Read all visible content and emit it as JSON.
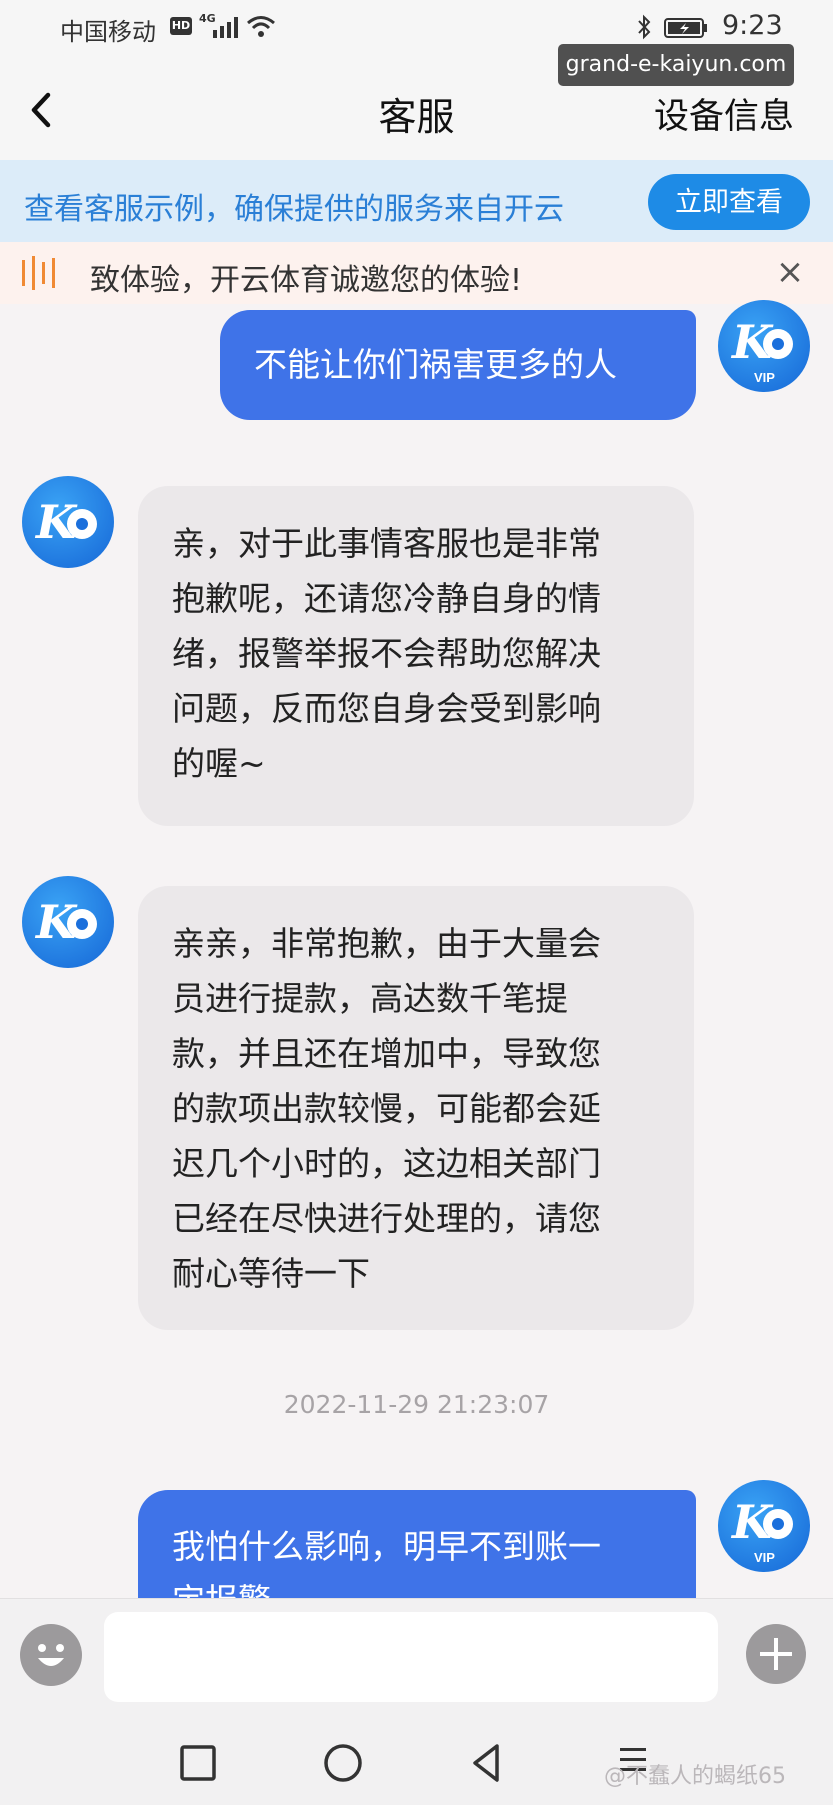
{
  "status_bar": {
    "carrier": "中国移动",
    "hd": "HD",
    "network": "4G",
    "time": "9:23"
  },
  "watermark": {
    "url": "grand-e-kaiyun.com",
    "author": "@不蠢人的蝎纸65"
  },
  "header": {
    "title": "客服",
    "right_action": "设备信息"
  },
  "tip_banner": {
    "text": "查看客服示例，确保提供的服务来自开云",
    "button": "立即查看"
  },
  "notice": {
    "text": "致体验，开云体育诚邀您的体验!",
    "close": "×"
  },
  "messages": [
    {
      "from": "user",
      "text": "不能让你们祸害更多的人",
      "avatar_badge": "VIP"
    },
    {
      "from": "agent",
      "lines": [
        "亲，对于此事情客服也是非常",
        "抱歉呢，还请您冷静自身的情",
        "绪，报警举报不会帮助您解决",
        "问题，反而您自身会受到影响",
        "的喔~"
      ]
    },
    {
      "from": "agent",
      "lines": [
        "亲亲，非常抱歉，由于大量会",
        "员进行提款，高达数千笔提",
        "款，并且还在增加中，导致您",
        "的款项出款较慢，可能都会延",
        "迟几个小时的，这边相关部门",
        "已经在尽快进行处理的，请您",
        "耐心等待一下"
      ]
    },
    {
      "from": "user",
      "lines": [
        "我怕什么影响，明早不到账一",
        "定报警"
      ],
      "avatar_badge": "VIP"
    }
  ],
  "timestamp": "2022-11-29 21:23:07",
  "input": {
    "placeholder": ""
  },
  "icons": {
    "back": "chevron-left-icon",
    "notice": "speaker-bars-icon",
    "emoji": "smiley-icon",
    "plus": "plus-icon"
  },
  "colors": {
    "accent": "#1e8be6",
    "user_bubble": "#3f73e8",
    "agent_bubble": "#ebe8ea",
    "tip_text": "#2a7fd6",
    "banner_bg": "#dcecf9"
  }
}
